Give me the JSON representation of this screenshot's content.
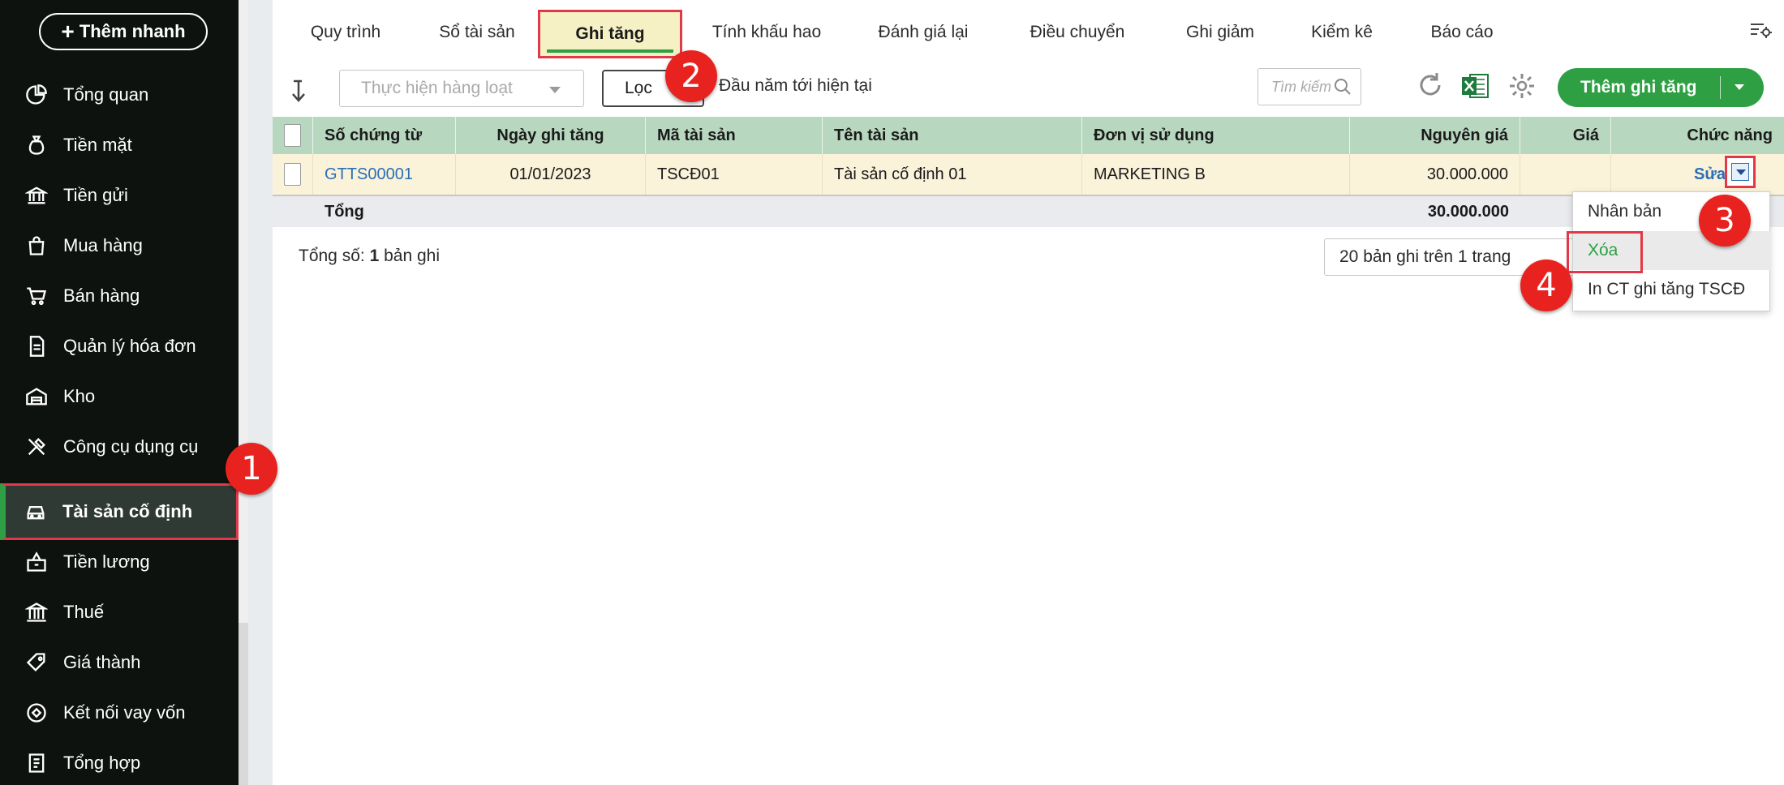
{
  "sidebar": {
    "quick_add_label": "Thêm nhanh",
    "items": [
      {
        "label": "Tổng quan",
        "icon": "chart-pie-icon"
      },
      {
        "label": "Tiền mặt",
        "icon": "money-bag-icon"
      },
      {
        "label": "Tiền gửi",
        "icon": "bank-icon"
      },
      {
        "label": "Mua hàng",
        "icon": "shopping-bag-icon"
      },
      {
        "label": "Bán hàng",
        "icon": "cart-icon"
      },
      {
        "label": "Quản lý hóa đơn",
        "icon": "invoice-icon"
      },
      {
        "label": "Kho",
        "icon": "warehouse-icon"
      },
      {
        "label": "Công cụ dụng cụ",
        "icon": "tools-icon"
      },
      {
        "label": "Tài sản cố định",
        "icon": "car-icon"
      },
      {
        "label": "Tiền lương",
        "icon": "payroll-icon"
      },
      {
        "label": "Thuế",
        "icon": "tax-building-icon"
      },
      {
        "label": "Giá thành",
        "icon": "price-tag-icon"
      },
      {
        "label": "Kết nối vay vốn",
        "icon": "loan-link-icon"
      },
      {
        "label": "Tổng hợp",
        "icon": "summary-icon"
      }
    ]
  },
  "tabs": [
    "Quy trình",
    "Sổ tài sản",
    "Ghi tăng",
    "Tính khấu hao",
    "Đánh giá lại",
    "Điều chuyển",
    "Ghi giảm",
    "Kiểm kê",
    "Báo cáo"
  ],
  "toolbar": {
    "bulk_action_placeholder": "Thực hiện hàng loạt",
    "filter_label": "Lọc",
    "period_label": "Đầu năm tới hiện tại",
    "search_placeholder": "Tìm kiếm",
    "add_button_label": "Thêm ghi tăng"
  },
  "table": {
    "headers": [
      "Số chứng từ",
      "Ngày ghi tăng",
      "Mã tài sản",
      "Tên tài sản",
      "Đơn vị sử dụng",
      "Nguyên giá",
      "Giá",
      "Chức năng"
    ],
    "rows": [
      {
        "doc_no": "GTTS00001",
        "date": "01/01/2023",
        "asset_code": "TSCĐ01",
        "asset_name": "Tài sản cố định 01",
        "unit": "MARKETING B",
        "cost": "30.000.000",
        "action": "Sửa"
      }
    ],
    "total_label": "Tổng",
    "total_cost": "30.000.000"
  },
  "footer": {
    "count_prefix": "Tổng số: ",
    "count_value": "1",
    "count_suffix": " bản ghi",
    "pager_label": "20 bản ghi trên 1 trang"
  },
  "context_menu": [
    "Nhân bản",
    "Xóa",
    "In CT ghi tăng TSCĐ"
  ],
  "badges": [
    "1",
    "2",
    "3",
    "4"
  ],
  "colors": {
    "accent": "#2ea043",
    "highlight": "#e2394a",
    "sidebar_bg": "#0d120f",
    "header_bg": "#b8d7bf"
  }
}
